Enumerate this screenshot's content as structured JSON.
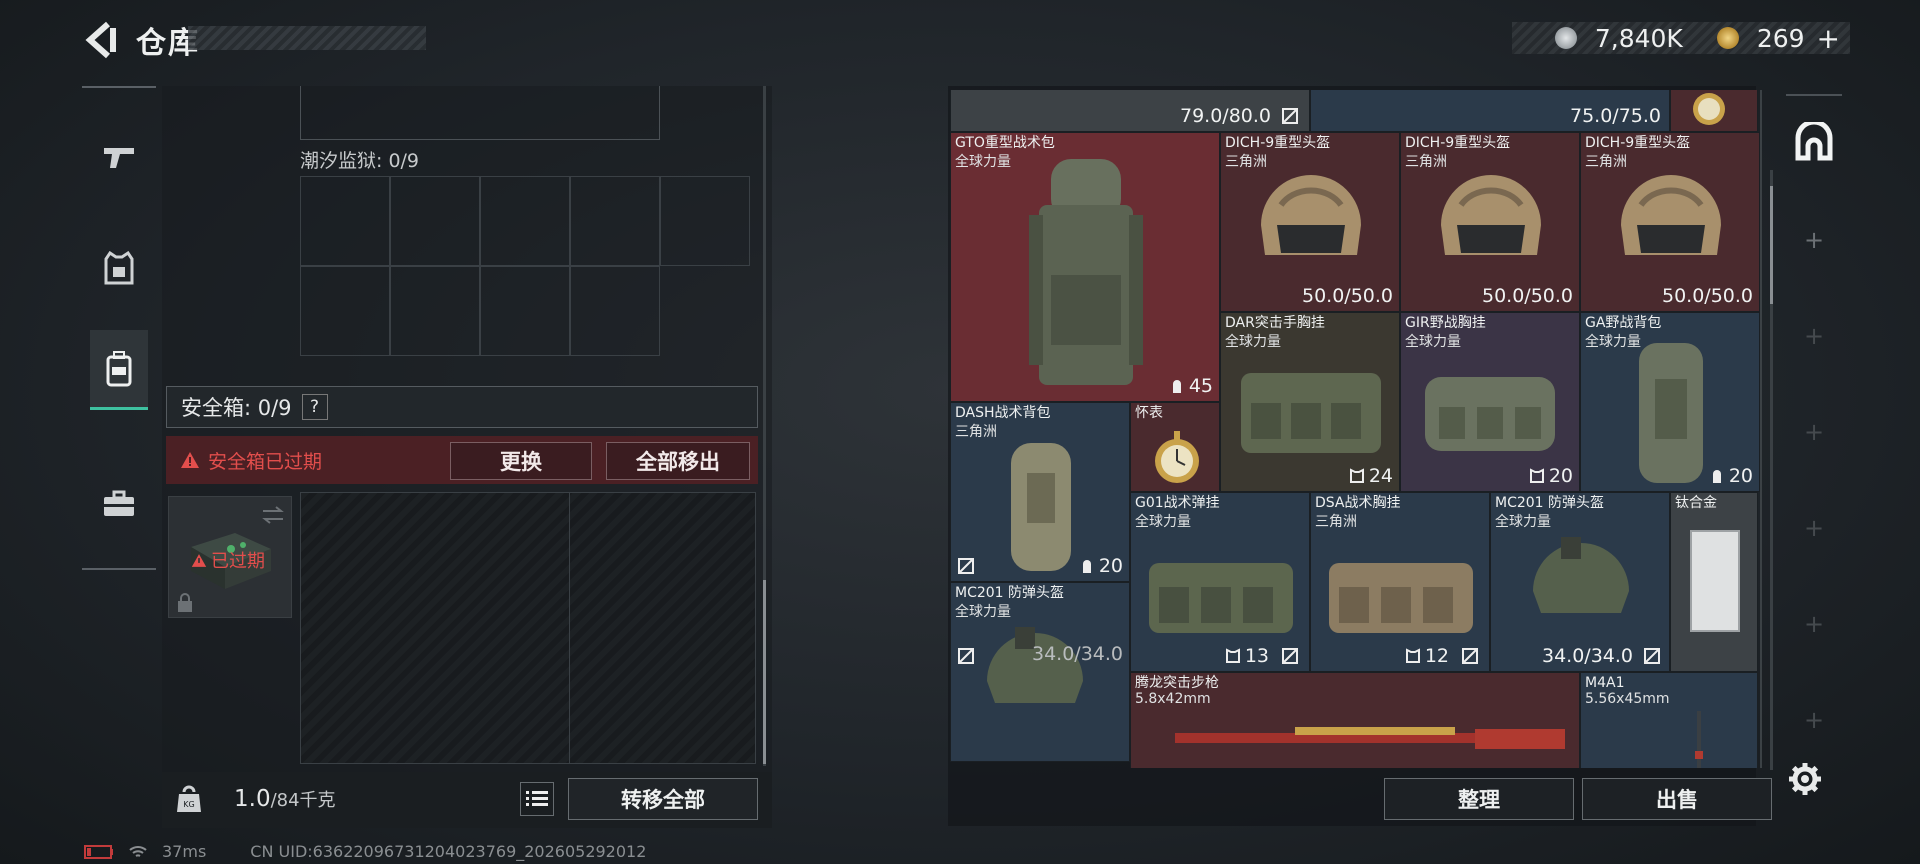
{
  "header": {
    "title": "仓库",
    "currencies": [
      {
        "name": "coin-silver-icon",
        "value": "7,840K",
        "color": "#b9bec2"
      },
      {
        "name": "coin-gold-icon",
        "value": "269",
        "color": "#c9a24a",
        "suffix": "+"
      }
    ]
  },
  "left_nav": [
    "gun-icon",
    "armor-icon",
    "backpack-icon",
    "briefcase-icon"
  ],
  "left_panel": {
    "tide_prison_label": "潮汐监狱: 0/9",
    "safebox_label": "安全箱: 0/9",
    "help_mark": "?",
    "expired_warning": "安全箱已过期",
    "replace_button": "更换",
    "move_all_button": "全部移出",
    "safebox_expired_tag": "已过期",
    "weight_value": "1.0",
    "weight_capacity": "/84千克",
    "transfer_all_button": "转移全部"
  },
  "status": {
    "ping": "37ms",
    "uid": "CN UID:63622096731204023769_202605292012"
  },
  "inventory": {
    "items": [
      {
        "name": "",
        "sub": "",
        "value": "79.0/80.0",
        "kind": "dur"
      },
      {
        "name": "",
        "sub": "",
        "value": "75.0/75.0",
        "kind": "dur"
      },
      {
        "name": "GTO重型战术包",
        "sub": "全球力量",
        "value": "45",
        "kind": "cnt"
      },
      {
        "name": "DICH-9重型头盔",
        "sub": "三角洲",
        "value": "50.0/50.0",
        "kind": "dur"
      },
      {
        "name": "DICH-9重型头盔",
        "sub": "三角洲",
        "value": "50.0/50.0",
        "kind": "dur"
      },
      {
        "name": "DICH-9重型头盔",
        "sub": "三角洲",
        "value": "50.0/50.0",
        "kind": "dur"
      },
      {
        "name": "DAR突击手胸挂",
        "sub": "全球力量",
        "value": "24",
        "kind": "cnt"
      },
      {
        "name": "GIR野战胸挂",
        "sub": "全球力量",
        "value": "20",
        "kind": "cnt"
      },
      {
        "name": "GA野战背包",
        "sub": "全球力量",
        "value": "20",
        "kind": "cnt"
      },
      {
        "name": "DASH战术背包",
        "sub": "三角洲",
        "value": "20",
        "kind": "cnt"
      },
      {
        "name": "怀表",
        "sub": "",
        "value": "",
        "kind": "none"
      },
      {
        "name": "G01战术弹挂",
        "sub": "全球力量",
        "value": "13",
        "kind": "cnt"
      },
      {
        "name": "DSA战术胸挂",
        "sub": "三角洲",
        "value": "12",
        "kind": "cnt"
      },
      {
        "name": "MC201 防弹头盔",
        "sub": "全球力量",
        "value": "34.0/34.0",
        "kind": "dur"
      },
      {
        "name": "钛合金",
        "sub": "",
        "value": "",
        "kind": "none"
      },
      {
        "name": "MC201 防弹头盔",
        "sub": "全球力量",
        "value": "34.0/34.0",
        "kind": "dur"
      },
      {
        "name": "腾龙突击步枪",
        "sub": "5.8x42mm",
        "value": "",
        "kind": "none"
      },
      {
        "name": "M4A1",
        "sub": "5.56x45mm",
        "value": "",
        "kind": "none"
      }
    ]
  },
  "bottom_buttons": {
    "sort": "整理",
    "sell": "出售"
  },
  "right_rail": [
    "vault-icon",
    "add-icon",
    "add-icon",
    "add-icon",
    "add-icon",
    "add-icon",
    "add-icon",
    "add-icon"
  ],
  "colors": {
    "accent": "#3ec1a0",
    "warning": "#e24e4c",
    "rare_red": "#6a2d33",
    "rare_blue": "#2b3a4a",
    "rare_purple": "#3b3446"
  }
}
